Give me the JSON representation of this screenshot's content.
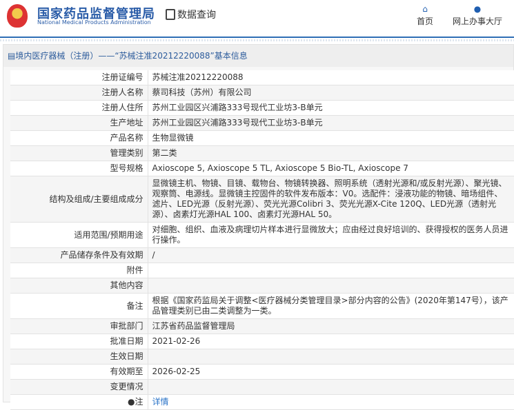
{
  "header": {
    "logo_cn": "国家药品监督管理局",
    "logo_en": "National Medical Products Administration",
    "section": "数据查询",
    "nav": [
      {
        "label": "首页",
        "icon": "home-icon"
      },
      {
        "label": "网上办事大厅",
        "icon": "user-icon"
      }
    ]
  },
  "panel": {
    "title": "境内医疗器械（注册）——“苏械注准20212220088”基本信息"
  },
  "rows": [
    {
      "label": "注册证编号",
      "value": "苏械注准20212220088"
    },
    {
      "label": "注册人名称",
      "value": "蔡司科技（苏州）有限公司"
    },
    {
      "label": "注册人住所",
      "value": "苏州工业园区兴浦路333号现代工业坊3-B单元"
    },
    {
      "label": "生产地址",
      "value": "苏州工业园区兴浦路333号现代工业坊3-B单元"
    },
    {
      "label": "产品名称",
      "value": "生物显微镜"
    },
    {
      "label": "管理类别",
      "value": "第二类"
    },
    {
      "label": "型号规格",
      "value": "Axioscope 5, Axioscope 5 TL, Axioscope 5 Bio-TL, Axioscope 7"
    },
    {
      "label": "结构及组成/主要组成成分",
      "value": "显微镜主机、物镜、目镜、载物台、物镜转换器、照明系统（透射光源和/或反射光源）、聚光镜、观察筒、电源线。显微镜主控固件的软件发布版本：V0。选配件：浸液功能的物镜、暗场组件、滤片、LED光源（反射光源）、荧光光源Colibri 3、荧光光源X-Cite 120Q、LED光源（透射光源）、卤素灯光源HAL 100、卤素灯光源HAL 50。"
    },
    {
      "label": "适用范围/预期用途",
      "value": "对细胞、组织、血液及病理切片样本进行显微放大；应由经过良好培训的、获得授权的医务人员进行操作。"
    },
    {
      "label": "产品储存条件及有效期",
      "value": "/"
    },
    {
      "label": "附件",
      "value": ""
    },
    {
      "label": "其他内容",
      "value": ""
    },
    {
      "label": "备注",
      "value": "根据《国家药监局关于调整<医疗器械分类管理目录>部分内容的公告》(2020年第147号），该产品管理类别已由二类调整为一类。"
    },
    {
      "label": "审批部门",
      "value": "江苏省药品监督管理局"
    },
    {
      "label": "批准日期",
      "value": "2021-02-26"
    },
    {
      "label": "生效日期",
      "value": ""
    },
    {
      "label": "有效期至",
      "value": "2026-02-25"
    },
    {
      "label": "变更情况",
      "value": ""
    }
  ],
  "note": {
    "label": "注",
    "link": "详情"
  }
}
